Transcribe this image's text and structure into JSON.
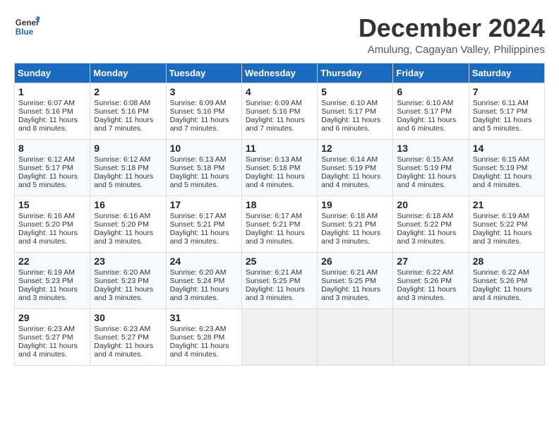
{
  "logo": {
    "line1": "General",
    "line2": "Blue"
  },
  "title": "December 2024",
  "subtitle": "Amulung, Cagayan Valley, Philippines",
  "days_of_week": [
    "Sunday",
    "Monday",
    "Tuesday",
    "Wednesday",
    "Thursday",
    "Friday",
    "Saturday"
  ],
  "weeks": [
    [
      {
        "day": "1",
        "sunrise": "Sunrise: 6:07 AM",
        "sunset": "Sunset: 5:16 PM",
        "daylight": "Daylight: 11 hours and 8 minutes."
      },
      {
        "day": "2",
        "sunrise": "Sunrise: 6:08 AM",
        "sunset": "Sunset: 5:16 PM",
        "daylight": "Daylight: 11 hours and 7 minutes."
      },
      {
        "day": "3",
        "sunrise": "Sunrise: 6:09 AM",
        "sunset": "Sunset: 5:16 PM",
        "daylight": "Daylight: 11 hours and 7 minutes."
      },
      {
        "day": "4",
        "sunrise": "Sunrise: 6:09 AM",
        "sunset": "Sunset: 5:16 PM",
        "daylight": "Daylight: 11 hours and 7 minutes."
      },
      {
        "day": "5",
        "sunrise": "Sunrise: 6:10 AM",
        "sunset": "Sunset: 5:17 PM",
        "daylight": "Daylight: 11 hours and 6 minutes."
      },
      {
        "day": "6",
        "sunrise": "Sunrise: 6:10 AM",
        "sunset": "Sunset: 5:17 PM",
        "daylight": "Daylight: 11 hours and 6 minutes."
      },
      {
        "day": "7",
        "sunrise": "Sunrise: 6:11 AM",
        "sunset": "Sunset: 5:17 PM",
        "daylight": "Daylight: 11 hours and 5 minutes."
      }
    ],
    [
      {
        "day": "8",
        "sunrise": "Sunrise: 6:12 AM",
        "sunset": "Sunset: 5:17 PM",
        "daylight": "Daylight: 11 hours and 5 minutes."
      },
      {
        "day": "9",
        "sunrise": "Sunrise: 6:12 AM",
        "sunset": "Sunset: 5:18 PM",
        "daylight": "Daylight: 11 hours and 5 minutes."
      },
      {
        "day": "10",
        "sunrise": "Sunrise: 6:13 AM",
        "sunset": "Sunset: 5:18 PM",
        "daylight": "Daylight: 11 hours and 5 minutes."
      },
      {
        "day": "11",
        "sunrise": "Sunrise: 6:13 AM",
        "sunset": "Sunset: 5:18 PM",
        "daylight": "Daylight: 11 hours and 4 minutes."
      },
      {
        "day": "12",
        "sunrise": "Sunrise: 6:14 AM",
        "sunset": "Sunset: 5:19 PM",
        "daylight": "Daylight: 11 hours and 4 minutes."
      },
      {
        "day": "13",
        "sunrise": "Sunrise: 6:15 AM",
        "sunset": "Sunset: 5:19 PM",
        "daylight": "Daylight: 11 hours and 4 minutes."
      },
      {
        "day": "14",
        "sunrise": "Sunrise: 6:15 AM",
        "sunset": "Sunset: 5:19 PM",
        "daylight": "Daylight: 11 hours and 4 minutes."
      }
    ],
    [
      {
        "day": "15",
        "sunrise": "Sunrise: 6:16 AM",
        "sunset": "Sunset: 5:20 PM",
        "daylight": "Daylight: 11 hours and 4 minutes."
      },
      {
        "day": "16",
        "sunrise": "Sunrise: 6:16 AM",
        "sunset": "Sunset: 5:20 PM",
        "daylight": "Daylight: 11 hours and 3 minutes."
      },
      {
        "day": "17",
        "sunrise": "Sunrise: 6:17 AM",
        "sunset": "Sunset: 5:21 PM",
        "daylight": "Daylight: 11 hours and 3 minutes."
      },
      {
        "day": "18",
        "sunrise": "Sunrise: 6:17 AM",
        "sunset": "Sunset: 5:21 PM",
        "daylight": "Daylight: 11 hours and 3 minutes."
      },
      {
        "day": "19",
        "sunrise": "Sunrise: 6:18 AM",
        "sunset": "Sunset: 5:21 PM",
        "daylight": "Daylight: 11 hours and 3 minutes."
      },
      {
        "day": "20",
        "sunrise": "Sunrise: 6:18 AM",
        "sunset": "Sunset: 5:22 PM",
        "daylight": "Daylight: 11 hours and 3 minutes."
      },
      {
        "day": "21",
        "sunrise": "Sunrise: 6:19 AM",
        "sunset": "Sunset: 5:22 PM",
        "daylight": "Daylight: 11 hours and 3 minutes."
      }
    ],
    [
      {
        "day": "22",
        "sunrise": "Sunrise: 6:19 AM",
        "sunset": "Sunset: 5:23 PM",
        "daylight": "Daylight: 11 hours and 3 minutes."
      },
      {
        "day": "23",
        "sunrise": "Sunrise: 6:20 AM",
        "sunset": "Sunset: 5:23 PM",
        "daylight": "Daylight: 11 hours and 3 minutes."
      },
      {
        "day": "24",
        "sunrise": "Sunrise: 6:20 AM",
        "sunset": "Sunset: 5:24 PM",
        "daylight": "Daylight: 11 hours and 3 minutes."
      },
      {
        "day": "25",
        "sunrise": "Sunrise: 6:21 AM",
        "sunset": "Sunset: 5:25 PM",
        "daylight": "Daylight: 11 hours and 3 minutes."
      },
      {
        "day": "26",
        "sunrise": "Sunrise: 6:21 AM",
        "sunset": "Sunset: 5:25 PM",
        "daylight": "Daylight: 11 hours and 3 minutes."
      },
      {
        "day": "27",
        "sunrise": "Sunrise: 6:22 AM",
        "sunset": "Sunset: 5:26 PM",
        "daylight": "Daylight: 11 hours and 3 minutes."
      },
      {
        "day": "28",
        "sunrise": "Sunrise: 6:22 AM",
        "sunset": "Sunset: 5:26 PM",
        "daylight": "Daylight: 11 hours and 4 minutes."
      }
    ],
    [
      {
        "day": "29",
        "sunrise": "Sunrise: 6:23 AM",
        "sunset": "Sunset: 5:27 PM",
        "daylight": "Daylight: 11 hours and 4 minutes."
      },
      {
        "day": "30",
        "sunrise": "Sunrise: 6:23 AM",
        "sunset": "Sunset: 5:27 PM",
        "daylight": "Daylight: 11 hours and 4 minutes."
      },
      {
        "day": "31",
        "sunrise": "Sunrise: 6:23 AM",
        "sunset": "Sunset: 5:28 PM",
        "daylight": "Daylight: 11 hours and 4 minutes."
      },
      null,
      null,
      null,
      null
    ]
  ]
}
